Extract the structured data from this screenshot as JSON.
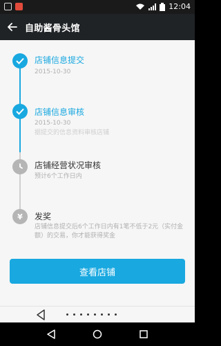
{
  "status_bar": {
    "time": "12:04",
    "icons": [
      "app-notification-icon",
      "red-app-icon",
      "wifi-icon",
      "signal-icon",
      "battery-icon"
    ]
  },
  "header": {
    "title": "自助酱骨头馆",
    "back_icon": "back-arrow-icon"
  },
  "steps": [
    {
      "title": "店铺信息提交",
      "date": "2015-10-30",
      "status": "done"
    },
    {
      "title": "店铺信息审核",
      "date": "2015-10-30",
      "note": "据提交的信息资料审核店铺",
      "status": "done"
    },
    {
      "title": "店铺经营状况审核",
      "note": "预计6个工作日内",
      "status": "pending"
    },
    {
      "title": "发奖",
      "note": "店铺信息提交后6个工作日内有1笔不低于2元（实付金额）的交易，你才能获得奖金",
      "status": "pending",
      "icon": "¥"
    }
  ],
  "primary_button": {
    "label": "查看店铺"
  },
  "pager": {
    "dots_count": 8
  },
  "colors": {
    "accent": "#19a8e0",
    "header_bg": "#202326"
  }
}
